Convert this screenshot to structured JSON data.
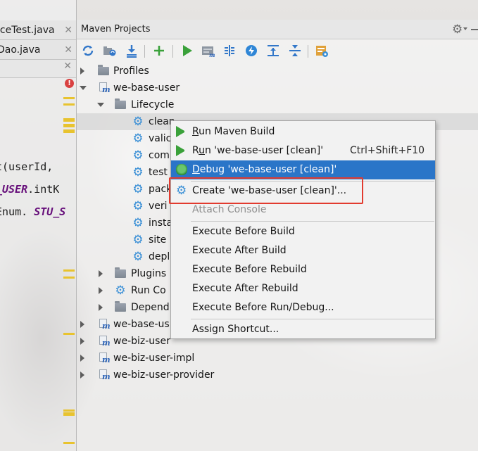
{
  "editor": {
    "tabs": [
      {
        "label": "iceTest.java"
      },
      {
        "label": "Dao.java"
      }
    ],
    "code_lines": [
      {
        "text": "t(userId,"
      },
      {
        "italic": "_USER",
        "rest": ".intK"
      },
      {
        "plain": "Enum.",
        "italic": "STU_S"
      }
    ]
  },
  "maven": {
    "title": "Maven Projects",
    "tree": [
      {
        "label": "Profiles"
      },
      {
        "label": "we-base-user"
      },
      {
        "label": "Lifecycle"
      },
      {
        "label": "clean"
      },
      {
        "label": "valic"
      },
      {
        "label": "com"
      },
      {
        "label": "test"
      },
      {
        "label": "pack"
      },
      {
        "label": "veri"
      },
      {
        "label": "insta"
      },
      {
        "label": "site"
      },
      {
        "label": "depl"
      },
      {
        "label": "Plugins"
      },
      {
        "label": "Run Co"
      },
      {
        "label": "Depend"
      },
      {
        "label": "we-base-us"
      },
      {
        "label": "we-biz-user"
      },
      {
        "label": "we-biz-user-impl"
      },
      {
        "label": "we-biz-user-provider"
      }
    ]
  },
  "context_menu": {
    "run_maven_build": {
      "mnemonic": "R",
      "rest": "un Maven Build"
    },
    "run_config": {
      "pre": "R",
      "mnemonic": "u",
      "rest": "n 'we-base-user [clean]'",
      "shortcut": "Ctrl+Shift+F10"
    },
    "debug_config": {
      "mnemonic": "D",
      "rest": "ebug 'we-base-user [clean]'"
    },
    "create_config": {
      "label": "Create 'we-base-user [clean]'..."
    },
    "attach_console": {
      "label": "Attach Console"
    },
    "execute_before_build": {
      "label": "Execute Before Build"
    },
    "execute_after_build": {
      "label": "Execute After Build"
    },
    "execute_before_rebuild": {
      "label": "Execute Before Rebuild"
    },
    "execute_after_rebuild": {
      "label": "Execute After Rebuild"
    },
    "execute_before_run_debug": {
      "label": "Execute Before Run/Debug..."
    },
    "assign_shortcut": {
      "label": "Assign Shortcut..."
    }
  },
  "colors": {
    "accent": "#2a75c8",
    "highlight_box": "#e23b2f",
    "run_green": "#3aa13a",
    "gear_blue": "#3a8fd6"
  }
}
